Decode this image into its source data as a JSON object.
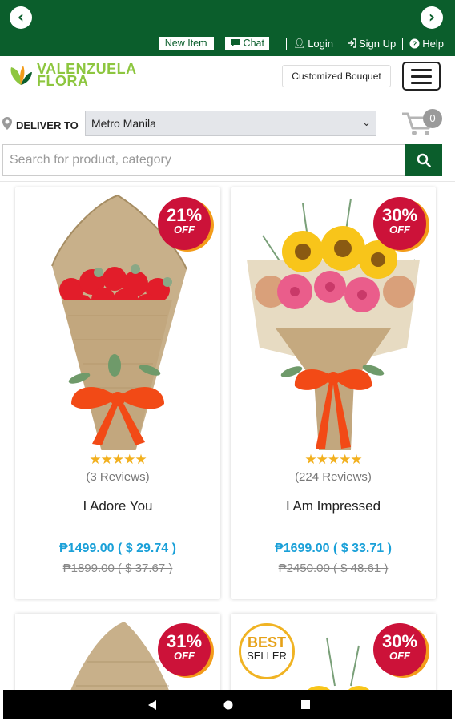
{
  "topbar": {
    "new_item": "New Item",
    "chat": "Chat",
    "login": "Login",
    "signup": "Sign Up",
    "help": "Help"
  },
  "brand": {
    "line1": "VALENZUELA",
    "line2": "FLORA",
    "color": "#8dc63f",
    "accent": "#0b5e2c"
  },
  "header": {
    "customized_bouquet": "Customized Bouquet"
  },
  "deliver": {
    "label": "DELIVER TO",
    "location": "Metro Manila"
  },
  "cart": {
    "count": "0"
  },
  "search": {
    "placeholder": "Search for product, category"
  },
  "products": [
    {
      "discount": "21%",
      "off": "OFF",
      "stars": "★★★★★",
      "reviews": "(3 Reviews)",
      "name": "I Adore You",
      "price": "₱1499.00 ( $ 29.74 )",
      "old_price": "₱1899.00 ( $ 37.67 )"
    },
    {
      "discount": "30%",
      "off": "OFF",
      "stars": "★★★★★",
      "reviews": "(224 Reviews)",
      "name": "I Am Impressed",
      "price": "₱1699.00 ( $ 33.71 )",
      "old_price": "₱2450.00 ( $ 48.61 )"
    },
    {
      "discount": "31%",
      "off": "OFF"
    },
    {
      "discount": "30%",
      "off": "OFF",
      "best_1": "BEST",
      "best_2": "SELLER"
    }
  ]
}
